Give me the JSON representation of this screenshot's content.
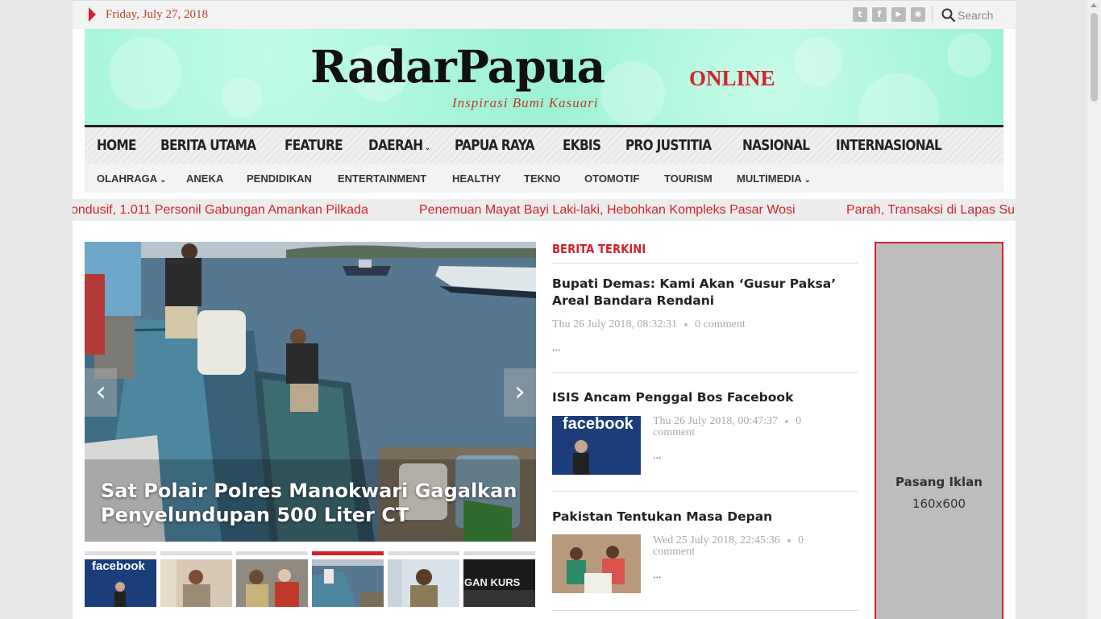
{
  "topbar": {
    "date": "Friday, July 27, 2018",
    "social": [
      {
        "name": "twitter-icon",
        "glyph": "t"
      },
      {
        "name": "facebook-icon",
        "glyph": "f"
      },
      {
        "name": "youtube-icon",
        "glyph": "▶"
      },
      {
        "name": "rss-icon",
        "glyph": "◉"
      }
    ],
    "search_placeholder": "Search"
  },
  "banner": {
    "logo": "RadarPapua",
    "logo_suffix": "ONLINE",
    "tagline": "Inspirasi Bumi Kasuari"
  },
  "main_nav": [
    "HOME",
    "BERITA UTAMA",
    "FEATURE",
    "DAERAH",
    "PAPUA RAYA",
    "EKBIS",
    "PRO JUSTITIA",
    "NASIONAL",
    "INTERNASIONAL"
  ],
  "sub_nav": [
    "OLAHRAGA",
    "ANEKA",
    "PENDIDIKAN",
    "ENTERTAINMENT",
    "HEALTHY",
    "TEKNO",
    "OTOMOTIF",
    "TOURISM",
    "MULTIMEDIA"
  ],
  "ticker": [
    "ondusif, 1.011 Personil Gabungan Amankan Pilkada",
    "Penemuan Mayat Bayi Laki-laki, Hebohkan Kompleks Pasar Wosi",
    "Parah, Transaksi di Lapas Su"
  ],
  "slider": {
    "title": "Sat Polair Polres Manokwari Gagalkan Penyelundupan 500 Liter CT",
    "prev_label": "‹",
    "next_label": "›",
    "thumb_labels": [
      "facebook",
      "",
      "",
      "",
      "",
      "GAN KURS"
    ]
  },
  "latest": {
    "section_title": "BERITA TERKINI",
    "posts": [
      {
        "title": "Bupati Demas: Kami Akan ‘Gusur Paksa’ Areal Bandara Rendani",
        "date": "Thu 26 July 2018, 08:32:31",
        "comments": "0 comment",
        "excerpt": "..."
      },
      {
        "title": "ISIS Ancam Penggal Bos Facebook",
        "date": "Thu 26 July 2018, 00:47:37",
        "comments": "0",
        "comments_line2": "comment",
        "excerpt": "...",
        "img_label": "facebook"
      },
      {
        "title": "Pakistan Tentukan Masa Depan",
        "date": "Wed 25 July 2018, 22:45:36",
        "comments": "0",
        "comments_line2": "comment",
        "excerpt": "..."
      }
    ]
  },
  "ad": {
    "title": "Pasang Iklan",
    "size": "160x600"
  },
  "colors": {
    "accent": "#d2232a",
    "banner": "#9af2d2",
    "text": "#222222"
  }
}
